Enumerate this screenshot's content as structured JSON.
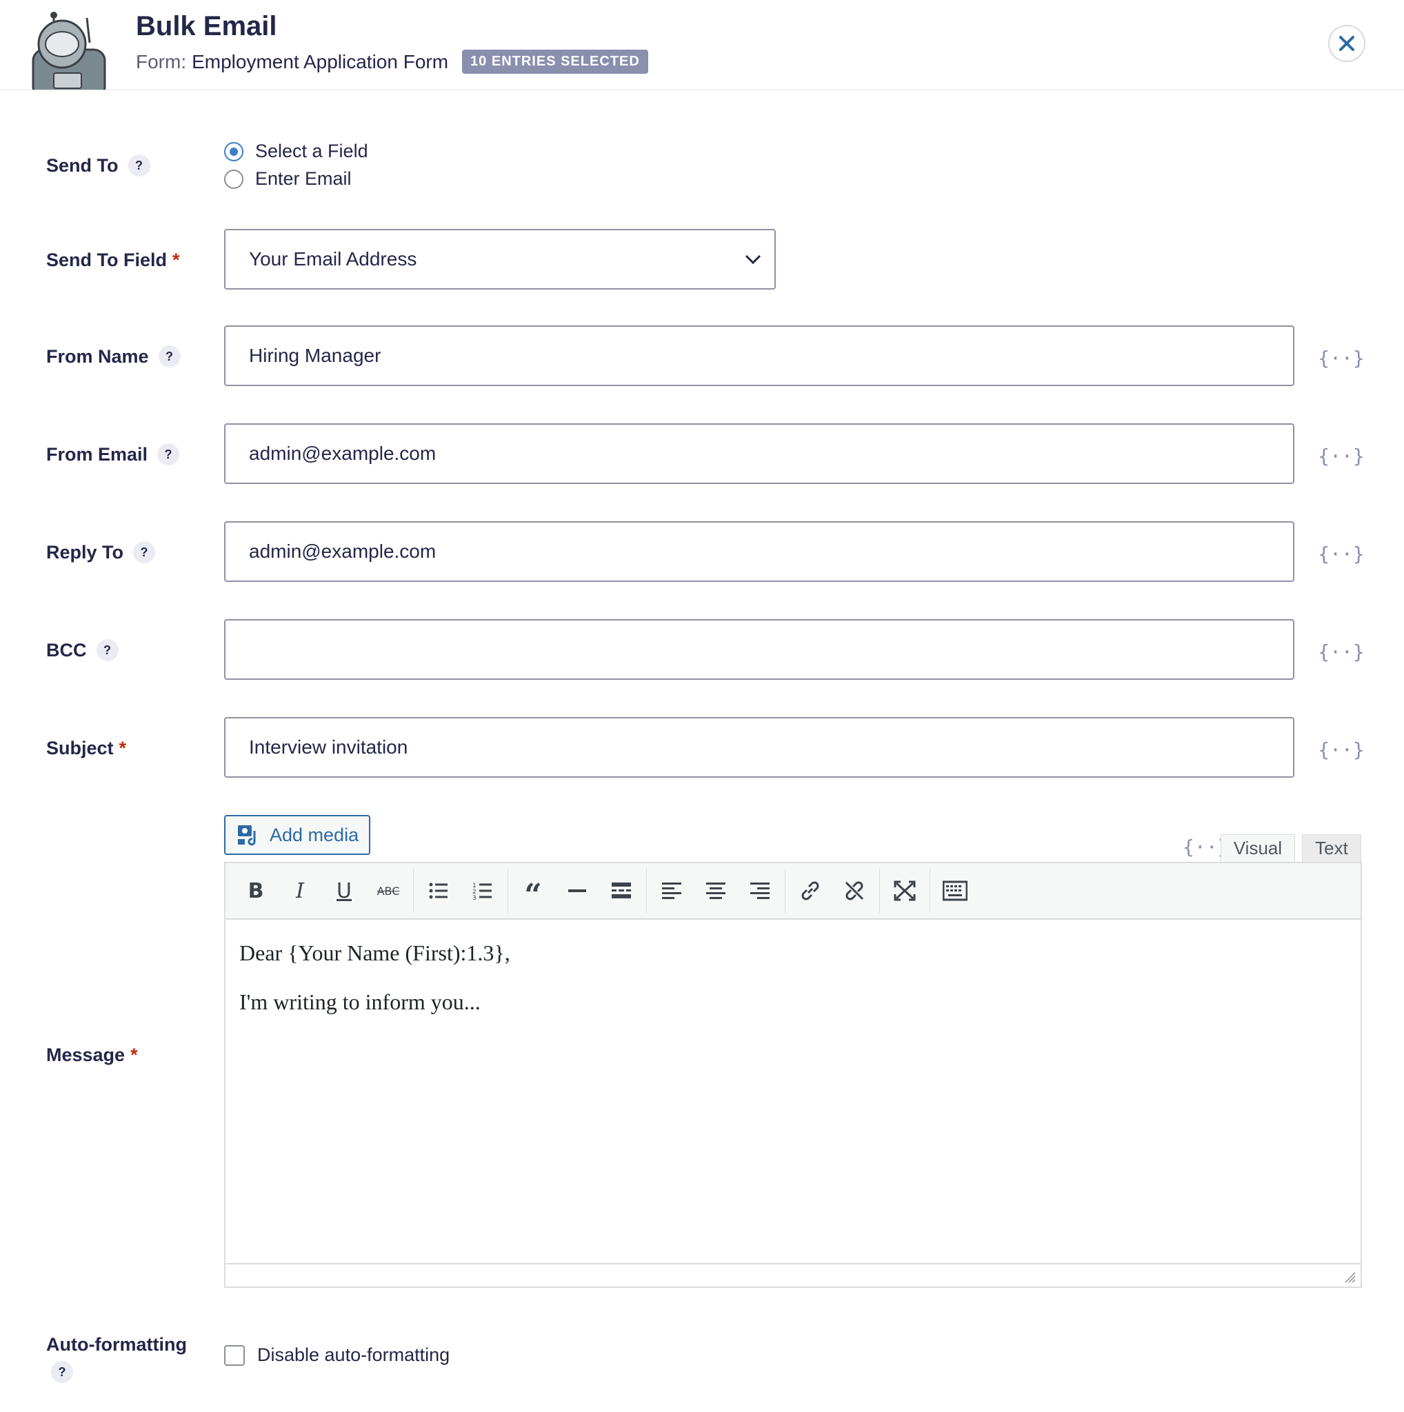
{
  "header": {
    "title": "Bulk Email",
    "form_prefix": "Form:",
    "form_name": "Employment Application Form",
    "badge": "10 ENTRIES SELECTED"
  },
  "fields": {
    "send_to": {
      "label": "Send To",
      "help": "?",
      "options": [
        {
          "label": "Select a Field",
          "checked": true
        },
        {
          "label": "Enter Email",
          "checked": false
        }
      ]
    },
    "send_to_field": {
      "label": "Send To Field",
      "required": "*",
      "value": "Your Email Address"
    },
    "from_name": {
      "label": "From Name",
      "help": "?",
      "value": "Hiring Manager"
    },
    "from_email": {
      "label": "From Email",
      "help": "?",
      "value": "admin@example.com"
    },
    "reply_to": {
      "label": "Reply To",
      "help": "?",
      "value": "admin@example.com"
    },
    "bcc": {
      "label": "BCC",
      "help": "?",
      "value": ""
    },
    "subject": {
      "label": "Subject",
      "required": "*",
      "value": "Interview invitation"
    },
    "message": {
      "label": "Message",
      "required": "*",
      "add_media": "Add media",
      "tabs": [
        "Visual",
        "Text"
      ],
      "content": [
        "Dear {Your Name (First):1.3},",
        "I'm writing to inform you..."
      ]
    },
    "auto_formatting": {
      "label": "Auto-formatting",
      "help": "?",
      "checkbox_label": "Disable auto-formatting"
    }
  },
  "merge_tag_symbol": "{··}",
  "toolbar_icons": [
    "bold-icon",
    "italic-icon",
    "underline-icon",
    "strikethrough-icon",
    "bulleted-list-icon",
    "numbered-list-icon",
    "blockquote-icon",
    "horizontal-line-icon",
    "read-more-icon",
    "align-left-icon",
    "align-center-icon",
    "align-right-icon",
    "link-icon",
    "unlink-icon",
    "fullscreen-icon",
    "toolbar-toggle-icon"
  ],
  "colors": {
    "accent": "#2c6aa5",
    "required": "#c02b0a",
    "badge": "#8a8fae",
    "label": "#242748"
  }
}
